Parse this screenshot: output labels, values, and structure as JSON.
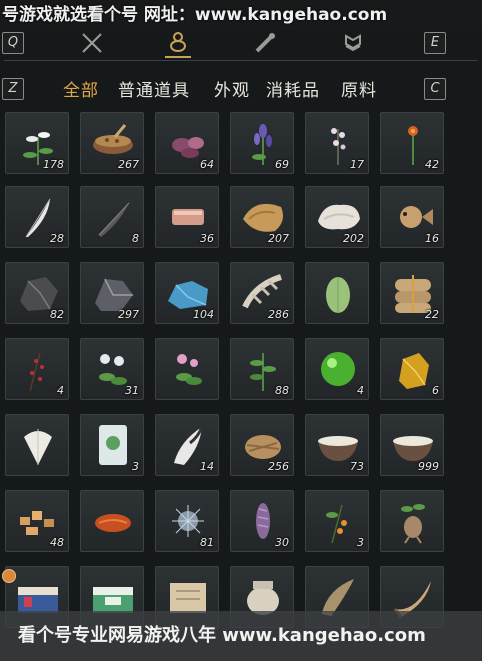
{
  "watermark_top": "号游戏就选看个号  网址：www.kangehao.com",
  "watermark_bottom": "看个号专业网易游戏八年  www.kangehao.com",
  "keys": {
    "q": "Q",
    "e": "E",
    "z": "Z",
    "c": "C"
  },
  "category_icons": [
    "swords-icon",
    "gourd-icon",
    "scroll-icon",
    "armor-icon"
  ],
  "tabs": [
    {
      "label": "全部",
      "active": true
    },
    {
      "label": "普通道具",
      "active": false
    },
    {
      "label": "外观",
      "active": false
    },
    {
      "label": "消耗品",
      "active": false
    },
    {
      "label": "原料",
      "active": false
    }
  ],
  "inventory": {
    "rows": [
      [
        {
          "icon": "white-lily-icon",
          "count": "178"
        },
        {
          "icon": "herb-bowl-icon",
          "count": "267"
        },
        {
          "icon": "purple-flower-icon",
          "count": "64"
        },
        {
          "icon": "lavender-icon",
          "count": "69"
        },
        {
          "icon": "white-blossom-icon",
          "count": "17"
        },
        {
          "icon": "red-flower-icon",
          "count": "42"
        }
      ],
      [
        {
          "icon": "feather-icon",
          "count": "28"
        },
        {
          "icon": "dark-feather-icon",
          "count": "8"
        },
        {
          "icon": "raw-meat-icon",
          "count": "36"
        },
        {
          "icon": "fungus-icon",
          "count": "207"
        },
        {
          "icon": "white-fungus-icon",
          "count": "202"
        },
        {
          "icon": "pufferfish-icon",
          "count": "16"
        }
      ],
      [
        {
          "icon": "coal-ore-icon",
          "count": "82"
        },
        {
          "icon": "iron-ore-icon",
          "count": "297"
        },
        {
          "icon": "blue-ore-icon",
          "count": "104"
        },
        {
          "icon": "bone-icon",
          "count": "286"
        },
        {
          "icon": "gourd-melon-icon",
          "count": ""
        },
        {
          "icon": "sack-icon",
          "count": "22"
        }
      ],
      [
        {
          "icon": "red-berry-branch-icon",
          "count": "4"
        },
        {
          "icon": "white-flower-herb-icon",
          "count": "31"
        },
        {
          "icon": "pink-flower-herb-icon",
          "count": ""
        },
        {
          "icon": "green-herb-icon",
          "count": "88"
        },
        {
          "icon": "green-orb-icon",
          "count": "4"
        },
        {
          "icon": "gold-nugget-icon",
          "count": "6"
        }
      ],
      [
        {
          "icon": "white-fan-flower-icon",
          "count": ""
        },
        {
          "icon": "jade-tablet-icon",
          "count": "3"
        },
        {
          "icon": "fur-tail-icon",
          "count": "14"
        },
        {
          "icon": "wood-bundle-icon",
          "count": "256"
        },
        {
          "icon": "milk-bowl-icon",
          "count": "73"
        },
        {
          "icon": "milk-bowl-icon",
          "count": "999"
        }
      ],
      [
        {
          "icon": "gold-chunks-icon",
          "count": "48"
        },
        {
          "icon": "red-shell-icon",
          "count": ""
        },
        {
          "icon": "ice-flower-icon",
          "count": "81"
        },
        {
          "icon": "purple-spike-icon",
          "count": "30"
        },
        {
          "icon": "orange-fruit-branch-icon",
          "count": "3"
        },
        {
          "icon": "mandrake-root-icon",
          "count": ""
        }
      ],
      [
        {
          "icon": "gift-box-icon",
          "count": ""
        },
        {
          "icon": "green-gift-box-icon",
          "count": ""
        },
        {
          "icon": "paper-scroll-icon",
          "count": ""
        },
        {
          "icon": "clay-jar-icon",
          "count": ""
        },
        {
          "icon": "horn-icon",
          "count": ""
        },
        {
          "icon": "curved-horn-icon",
          "count": ""
        }
      ]
    ]
  }
}
